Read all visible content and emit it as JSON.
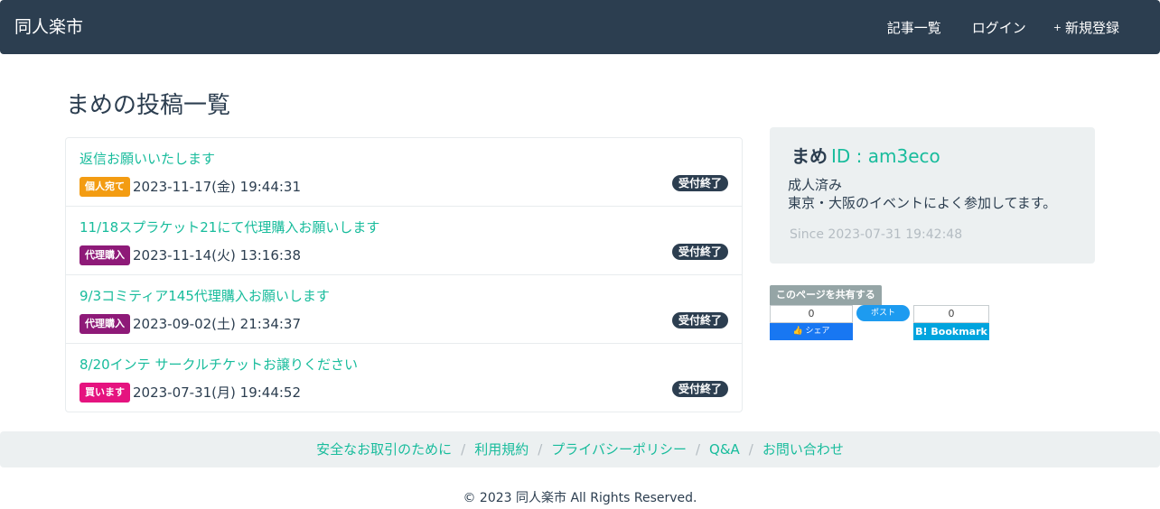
{
  "navbar": {
    "brand": "同人楽市",
    "links": [
      {
        "icon": "",
        "label": "記事一覧"
      },
      {
        "icon": "",
        "label": "ログイン"
      },
      {
        "icon": "+",
        "label": "新規登録"
      }
    ]
  },
  "page_title": "まめの投稿一覧",
  "posts": [
    {
      "title": "返信お願いいたします",
      "tag": "個人宛て",
      "tag_color": "#f39c12",
      "date": "2023-11-17(金) 19:44:31",
      "status": "受付終了"
    },
    {
      "title": "11/18スプラケット21にて代理購入お願いします",
      "tag": "代理購入",
      "tag_color": "#8e1a78",
      "date": "2023-11-14(火) 13:16:38",
      "status": "受付終了"
    },
    {
      "title": "9/3コミティア145代理購入お願いします",
      "tag": "代理購入",
      "tag_color": "#8e1a78",
      "date": "2023-09-02(土) 21:34:37",
      "status": "受付終了"
    },
    {
      "title": "8/20インテ サークルチケットお譲りください",
      "tag": "買います",
      "tag_color": "#e5137f",
      "date": "2023-07-31(月) 19:44:52",
      "status": "受付終了"
    }
  ],
  "profile": {
    "icon": "",
    "name": "まめ",
    "id_text": "ID : am3eco",
    "line1": "成人済み",
    "line2": "東京・大阪のイベントによく参加してます。",
    "since_icon": "",
    "since": "Since 2023-07-31 19:42:48"
  },
  "share": {
    "label": "このページを共有する",
    "fb_count": "0",
    "fb_label": "👍 シェア",
    "tw_label": "ポスト",
    "hb_count": "0",
    "hb_label": "B! Bookmark"
  },
  "footer": {
    "links": [
      "安全なお取引のために",
      "利用規約",
      "プライバシーポリシー",
      "Q&A",
      "お問い合わせ"
    ],
    "separator": "/",
    "copyright": "© 2023 同人楽市 All Rights Reserved."
  },
  "colors": {
    "navbar_bg": "#2c3e50",
    "accent": "#18bc9c",
    "panel_bg": "#ecf0f1"
  }
}
